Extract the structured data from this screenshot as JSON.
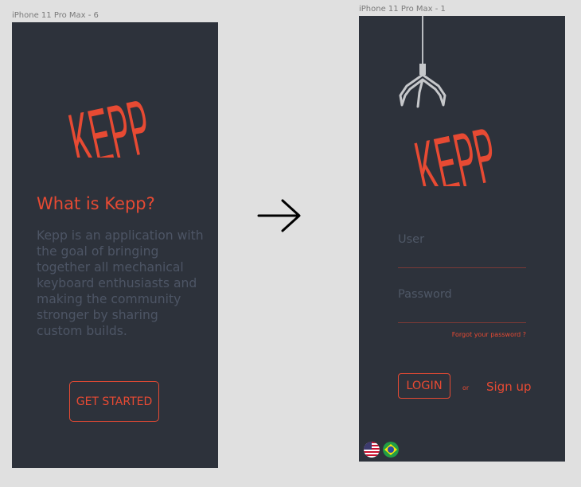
{
  "frames": {
    "left_title": "iPhone 11 Pro Max - 6",
    "right_title": "iPhone 11 Pro Max - 1"
  },
  "intro": {
    "logo": "KEPP",
    "heading": "What is Kepp?",
    "body": "Kepp is an application with the goal of bringing together all mechanical keyboard enthusiasts and making the community stronger by sharing custom builds.",
    "cta_label": "GET STARTED"
  },
  "login": {
    "logo": "KEPP",
    "user_label": "User",
    "password_label": "Password",
    "forgot_label": "Forgot your password ?",
    "login_label": "LOGIN",
    "or_label": "or",
    "signup_label": "Sign up",
    "flags": [
      "us-flag-icon",
      "brazil-flag-icon"
    ]
  },
  "colors": {
    "accent": "#e74a33",
    "background": "#2d323b",
    "muted_text": "#4d5565"
  },
  "icons": {
    "arrow": "arrow-right-icon",
    "claw": "claw-machine-icon"
  }
}
